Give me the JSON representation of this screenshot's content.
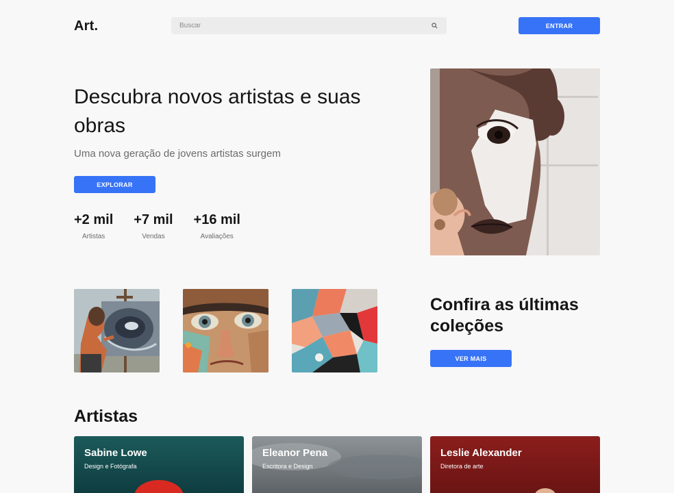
{
  "header": {
    "logo": "Art.",
    "search_placeholder": "Buscar",
    "login_label": "ENTRAR"
  },
  "hero": {
    "title": "Descubra novos artistas e suas obras",
    "subtitle": "Uma nova geração de jovens artistas surgem",
    "explore_label": "EXPLORAR",
    "stats": [
      {
        "value": "+2 mil",
        "label": "Artistas"
      },
      {
        "value": "+7 mil",
        "label": "Vendas"
      },
      {
        "value": "+16 mil",
        "label": "Avaliações"
      }
    ]
  },
  "collections": {
    "title": "Confira as últimas coleções",
    "more_label": "VER MAIS"
  },
  "artists": {
    "title": "Artistas",
    "items": [
      {
        "name": "Sabine Lowe",
        "role": "Design e Fotógrafa"
      },
      {
        "name": "Eleanor Pena",
        "role": "Escritora e Design"
      },
      {
        "name": "Leslie Alexander",
        "role": "Diretora de arte"
      }
    ]
  },
  "colors": {
    "accent": "#3773f7",
    "background": "#f8f8f8",
    "text": "#151515",
    "muted": "#6b6b6b"
  }
}
